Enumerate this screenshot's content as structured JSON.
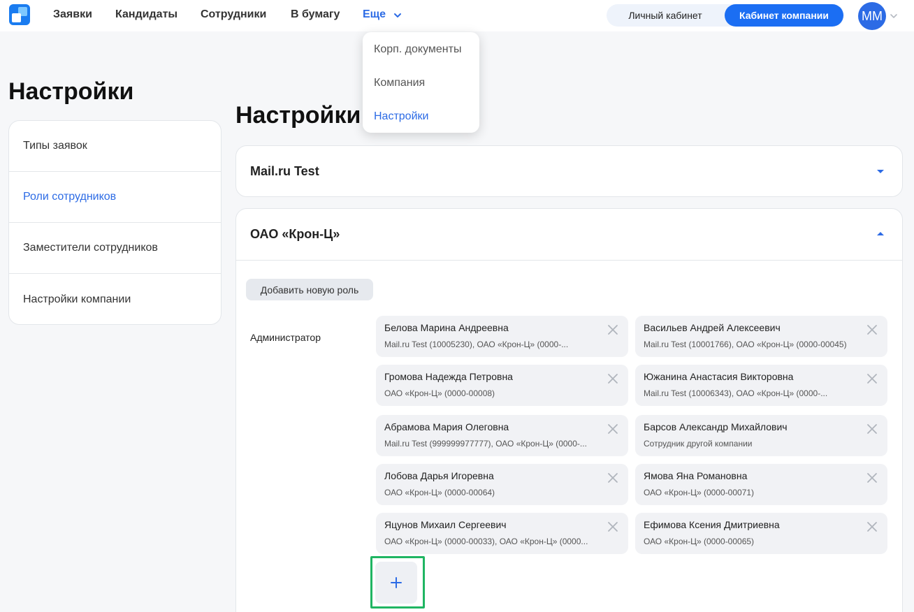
{
  "brand": {
    "accent": "#2c6be5",
    "primary_button": "#1b6ef3",
    "highlight": "#1fb562"
  },
  "nav": {
    "items": [
      "Заявки",
      "Кандидаты",
      "Сотрудники",
      "В бумагу",
      "Еще"
    ]
  },
  "cabinet_toggle": {
    "personal": "Личный кабинет",
    "company": "Кабинет компании"
  },
  "user": {
    "initials": "MM"
  },
  "more_menu": {
    "items": [
      "Корп. документы",
      "Компания",
      "Настройки"
    ],
    "active": "Настройки"
  },
  "page": {
    "title": "Настройки"
  },
  "side_menu": {
    "items": [
      "Типы заявок",
      "Роли сотрудников",
      "Заместители сотрудников",
      "Настройки компании"
    ],
    "active": "Роли сотрудников"
  },
  "main": {
    "title": "Настройки",
    "companies": [
      {
        "name": "Mail.ru Test",
        "expanded": false
      },
      {
        "name": "ОАО «Крон-Ц»",
        "expanded": true
      }
    ],
    "add_role_label": "Добавить новую роль",
    "role": {
      "name": "Администратор",
      "members": [
        {
          "name": "Белова Марина Андреевна",
          "meta": "Mail.ru Test (10005230), ОАО «Крон-Ц» (0000-..."
        },
        {
          "name": "Васильев Андрей Алексеевич",
          "meta": "Mail.ru Test (10001766), ОАО «Крон-Ц» (0000-00045)"
        },
        {
          "name": "Громова Надежда Петровна",
          "meta": "ОАО «Крон-Ц» (0000-00008)"
        },
        {
          "name": "Южанина Анастасия Викторовна",
          "meta": "Mail.ru Test (10006343), ОАО «Крон-Ц» (0000-..."
        },
        {
          "name": "Абрамова Мария Олеговна",
          "meta": "Mail.ru Test (999999977777), ОАО «Крон-Ц» (0000-..."
        },
        {
          "name": "Барсов Александр Михайлович",
          "meta": "Сотрудник другой компании"
        },
        {
          "name": "Лобова Дарья Игоревна",
          "meta": "ОАО «Крон-Ц» (0000-00064)"
        },
        {
          "name": "Ямова Яна Романовна",
          "meta": "ОАО «Крон-Ц» (0000-00071)"
        },
        {
          "name": "Яцунов Михаил Сергеевич",
          "meta": "ОАО «Крон-Ц» (0000-00033), ОАО «Крон-Ц» (0000..."
        },
        {
          "name": "Ефимова Ксения Дмитриевна",
          "meta": "ОАО «Крон-Ц» (0000-00065)"
        }
      ]
    },
    "add_member_icon": "plus-icon"
  }
}
